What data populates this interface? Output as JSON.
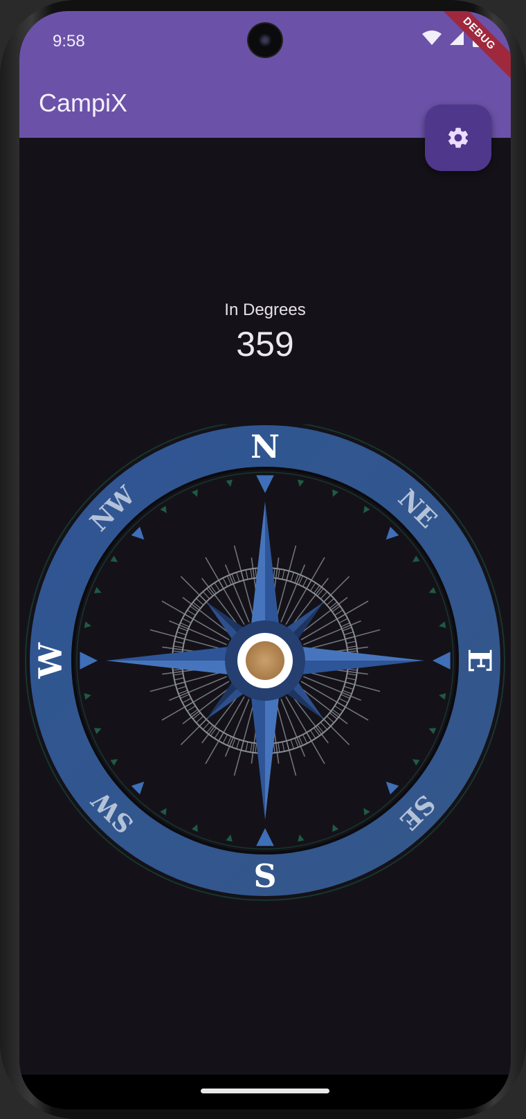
{
  "status": {
    "time": "9:58"
  },
  "appbar": {
    "title": "CampiX",
    "debug_label": "DEBUG"
  },
  "fab": {
    "icon": "settings-gear-icon"
  },
  "heading": {
    "label": "In Degrees",
    "value": "359"
  },
  "compass": {
    "cardinals": {
      "north": "N",
      "south": "S",
      "east": "E",
      "west": "W"
    },
    "intercardinals": {
      "northeast": "NE",
      "northwest": "NW",
      "southeast": "SE",
      "southwest": "SW"
    },
    "heading_degrees": 359
  },
  "colors": {
    "appbar": "#6b52a8",
    "fab": "#4f378b",
    "background": "#141218",
    "ring": "#335a93",
    "needle": "#3b66ad"
  }
}
